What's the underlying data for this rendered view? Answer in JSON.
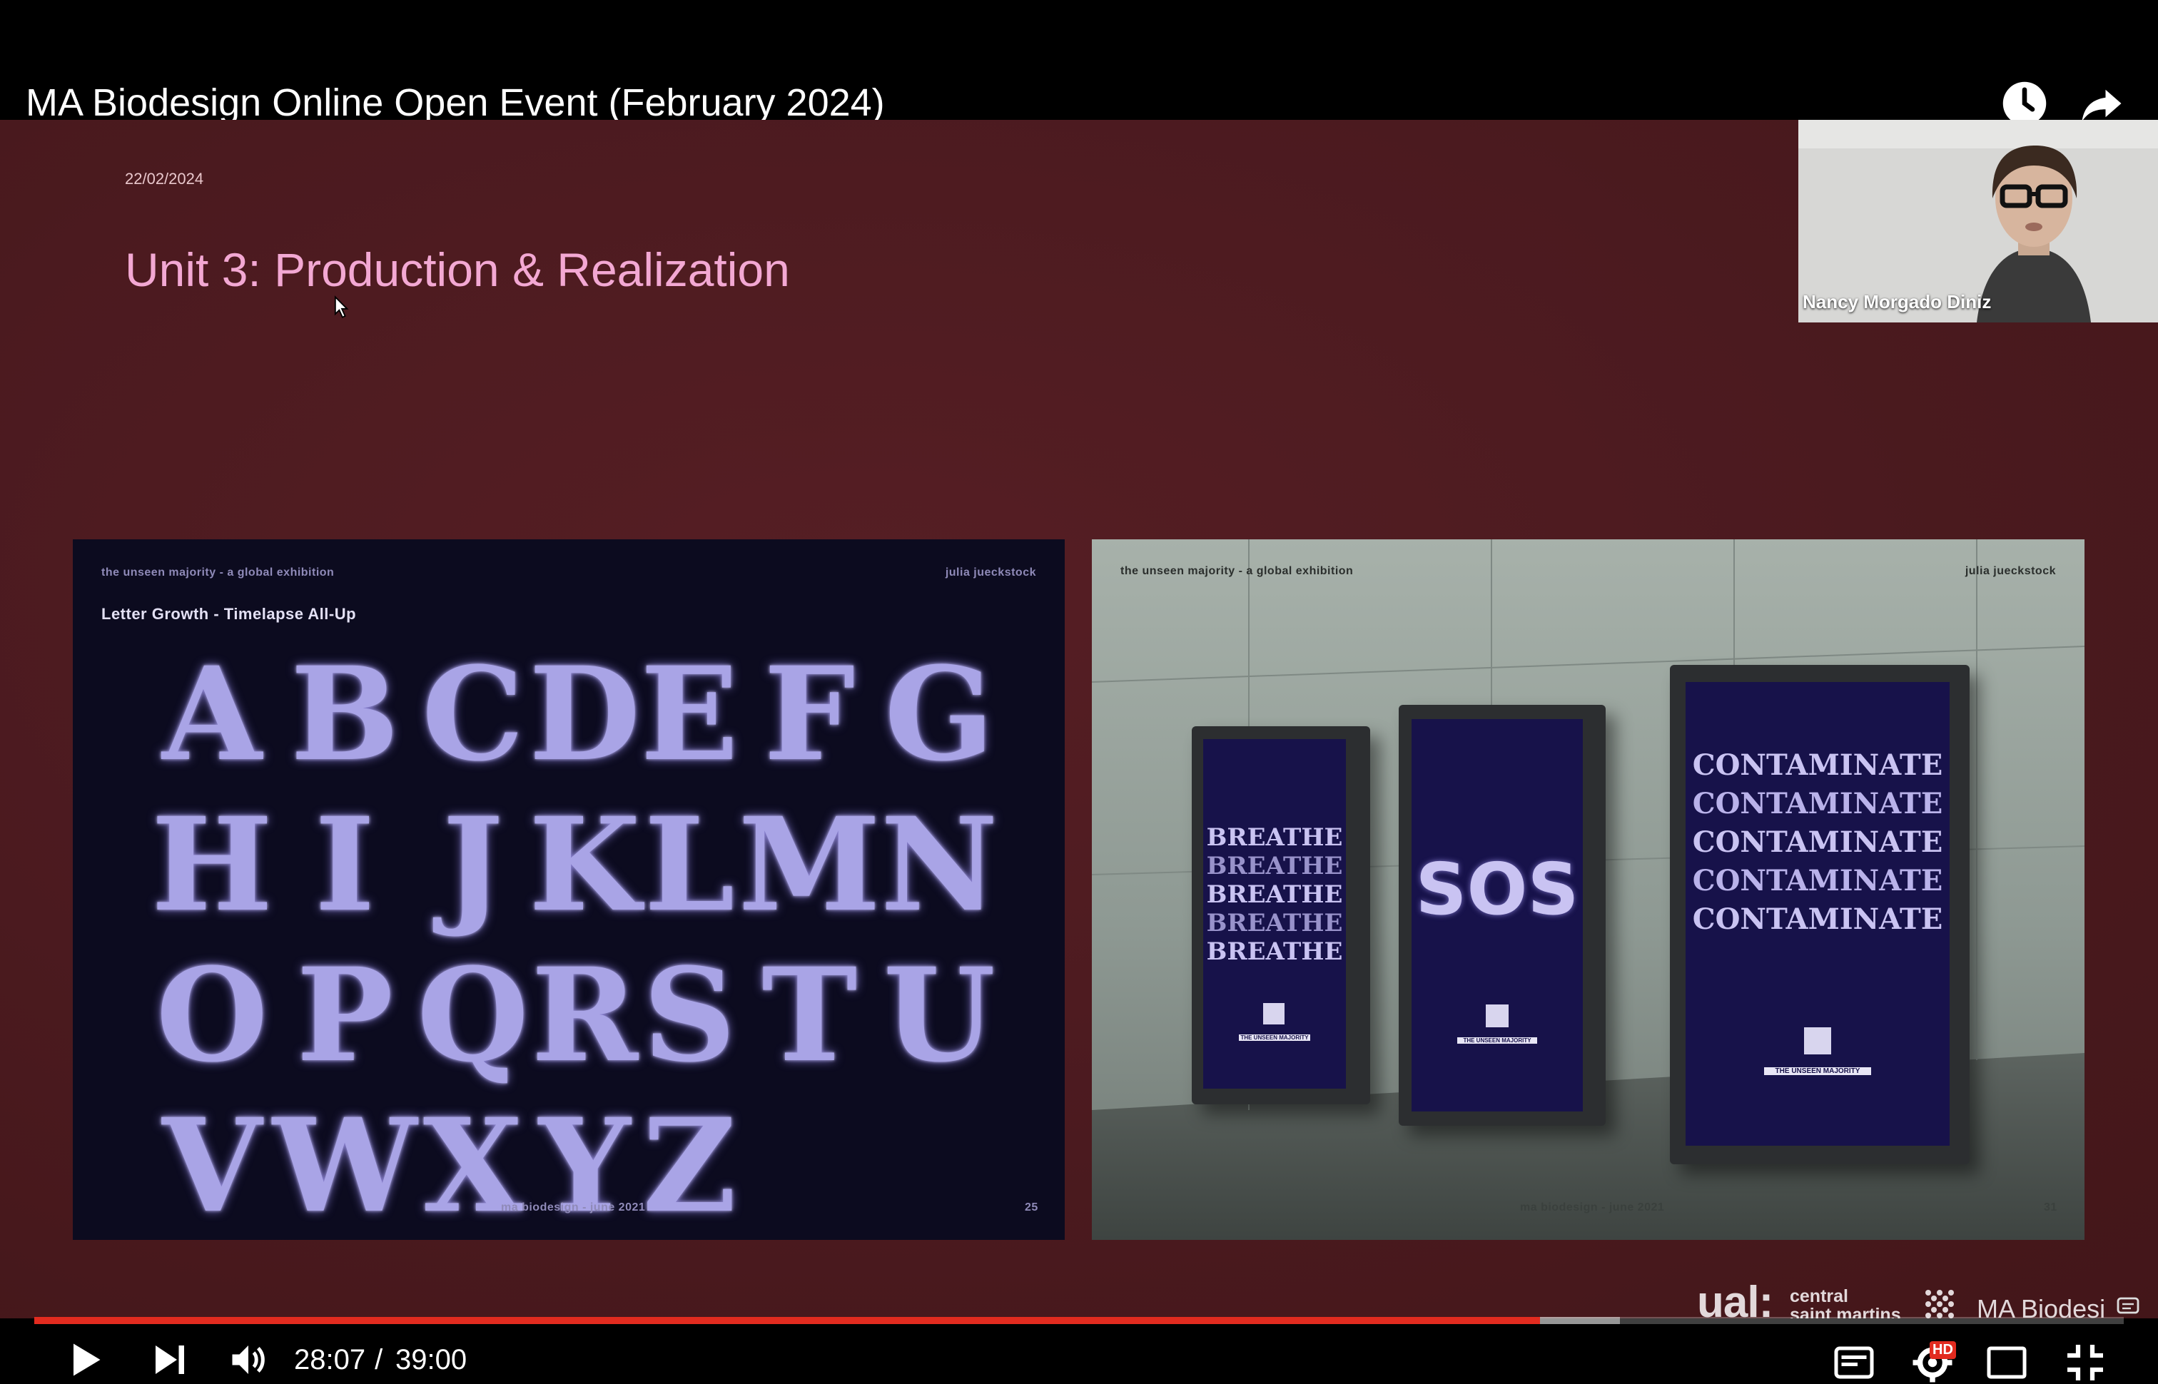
{
  "video": {
    "title": "MA Biodesign Online Open Event (February 2024)",
    "time_current": "28:07",
    "time_separator": " / ",
    "time_total": "39:00",
    "progress": 0.7205
  },
  "slide": {
    "date": "22/02/2024",
    "title": "Unit 3: Production & Realization",
    "left_panel": {
      "caption_left": "the unseen majority - a global exhibition",
      "caption_right": "julia jueckstock",
      "heading": "Letter Growth - Timelapse All-Up",
      "letters": [
        "A",
        "B",
        "C",
        "D",
        "E",
        "F",
        "G",
        "H",
        "I",
        "J",
        "K",
        "L",
        "M",
        "N",
        "O",
        "P",
        "Q",
        "R",
        "S",
        "T",
        "U",
        "V",
        "W",
        "X",
        "Y",
        "Z"
      ],
      "footer": "ma biodesign - june 2021",
      "page": "25"
    },
    "right_panel": {
      "caption_left": "the unseen majority - a global exhibition",
      "caption_right": "julia jueckstock",
      "poster_1_word": "BREATHE",
      "poster_2_word": "SOS",
      "poster_3_word": "CONTAMINATE",
      "poster_tag": "THE UNSEEN MAJORITY",
      "footer": "ma biodesign - june 2021",
      "page": "31"
    },
    "branding": {
      "ual": "ual:",
      "school": "central\nsaint martins",
      "course": "MA Biodesi"
    }
  },
  "webcam": {
    "speaker": "Nancy Morgado Diniz"
  },
  "icons": {
    "watch_later": "clock-icon",
    "share": "share-arrow-icon",
    "play": "play-icon",
    "next": "next-icon",
    "volume": "volume-icon",
    "chapters": "chapters-icon",
    "settings": "gear-icon",
    "miniplayer": "miniplayer-icon",
    "fullscreen": "exit-fullscreen-icon"
  },
  "badges": {
    "hd": "HD"
  },
  "colors": {
    "slide_bg": "#4b1a1f",
    "title_pink": "#f3a8d3",
    "progress_red": "#e22b1f"
  }
}
